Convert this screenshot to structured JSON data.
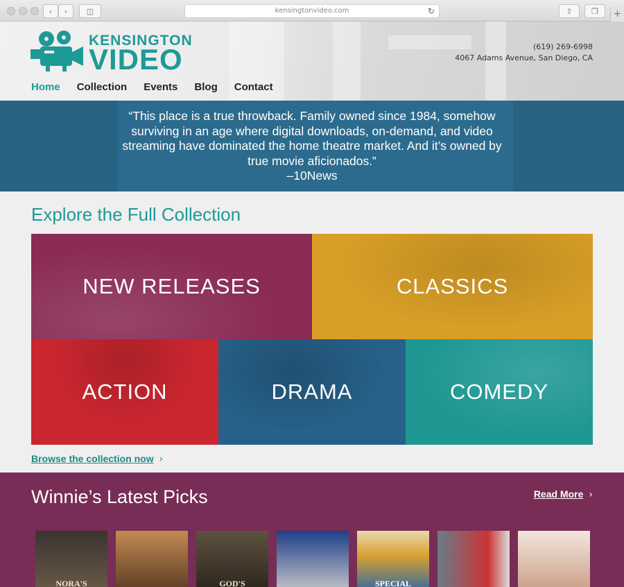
{
  "browser": {
    "url": "kensingtonvideo.com"
  },
  "header": {
    "logo_top": "KENSINGTON",
    "logo_bottom": "VIDEO",
    "phone": "(619) 269-6998",
    "address": "4067 Adams Avenue, San Diego, CA",
    "nav": [
      "Home",
      "Collection",
      "Events",
      "Blog",
      "Contact"
    ],
    "active_nav": "Home"
  },
  "quote": {
    "text": "“This place is a true throwback. Family owned since 1984, somehow surviving in an age where digital downloads, on-demand, and video streaming have dominated the home theatre market. And it’s owned by true movie aficionados.”",
    "attribution": "–10News"
  },
  "collection": {
    "title": "Explore the Full Collection",
    "tiles": [
      "NEW RELEASES",
      "CLASSICS",
      "ACTION",
      "DRAMA",
      "COMEDY"
    ],
    "browse_link": "Browse the collection now"
  },
  "picks": {
    "title": "Winnie’s Latest Picks",
    "read_more": "Read More",
    "covers": [
      {
        "caption": "NORA'S",
        "icon": "dvd-cover-icon"
      },
      {
        "caption": "",
        "icon": "dvd-cover-icon"
      },
      {
        "caption": "GOD'S",
        "icon": "dvd-cover-icon"
      },
      {
        "caption": "",
        "icon": "dvd-cover-icon"
      },
      {
        "caption": "SPECIAL",
        "icon": "dvd-cover-icon"
      },
      {
        "caption": "",
        "icon": "dvd-cover-icon"
      },
      {
        "caption": "",
        "icon": "dvd-cover-icon"
      }
    ]
  },
  "colors": {
    "brand_teal": "#1d9a96",
    "quote_blue": "#2c6b8d",
    "picks_purple": "#772d55",
    "new_releases": "#8a2b55",
    "classics": "#d89e26",
    "action": "#c9262f",
    "drama": "#276189",
    "comedy": "#1f9893"
  }
}
